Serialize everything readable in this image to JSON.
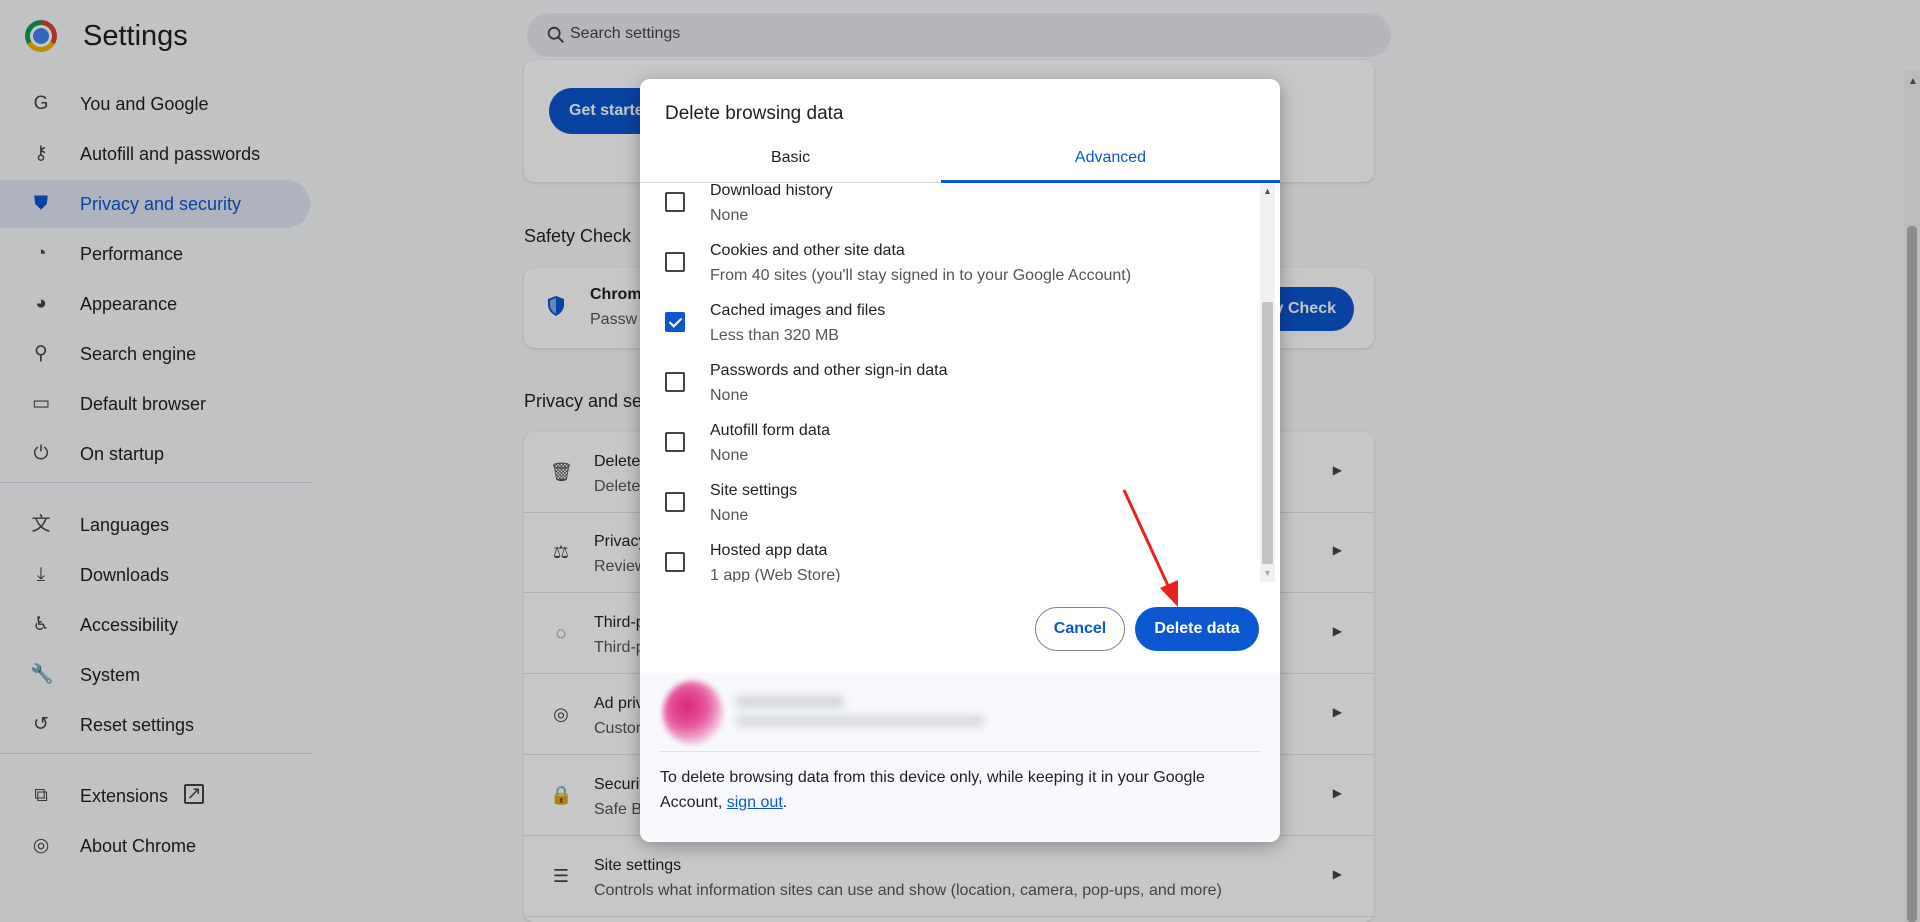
{
  "app": {
    "title": "Settings"
  },
  "search": {
    "placeholder": "Search settings"
  },
  "sidebar": {
    "items": [
      {
        "label": "You and Google",
        "icon": "google-icon"
      },
      {
        "label": "Autofill and passwords",
        "icon": "key-icon"
      },
      {
        "label": "Privacy and security",
        "icon": "shield-icon",
        "active": true
      },
      {
        "label": "Performance",
        "icon": "speedometer-icon"
      },
      {
        "label": "Appearance",
        "icon": "palette-icon"
      },
      {
        "label": "Search engine",
        "icon": "search-icon"
      },
      {
        "label": "Default browser",
        "icon": "browser-window-icon"
      },
      {
        "label": "On startup",
        "icon": "power-icon"
      },
      {
        "label": "Languages",
        "icon": "translate-icon"
      },
      {
        "label": "Downloads",
        "icon": "download-icon"
      },
      {
        "label": "Accessibility",
        "icon": "accessibility-icon"
      },
      {
        "label": "System",
        "icon": "wrench-icon"
      },
      {
        "label": "Reset settings",
        "icon": "reset-icon"
      },
      {
        "label": "Extensions",
        "icon": "puzzle-icon"
      },
      {
        "label": "About Chrome",
        "icon": "chrome-icon"
      }
    ]
  },
  "main": {
    "get_started": "Get starte",
    "safety_check_title": "Safety Check",
    "safety_check_row_title": "Chrom",
    "safety_check_row_sub": "Passw",
    "safety_check_button": "y Check",
    "privacy_title": "Privacy and se",
    "rows": [
      {
        "title": "Delete",
        "sub": "Delete",
        "icon": "trash-icon"
      },
      {
        "title": "Privacy",
        "sub": "Review",
        "icon": "privacy-guide-icon"
      },
      {
        "title": "Third-p",
        "sub": "Third-p",
        "icon": "cookie-icon"
      },
      {
        "title": "Ad priv",
        "sub": "Custor",
        "icon": "ad-privacy-icon"
      },
      {
        "title": "Securit",
        "sub": "Safe B",
        "icon": "lock-icon"
      },
      {
        "title": "Site settings",
        "sub": "Controls what information sites can use and show (location, camera, pop-ups, and more)",
        "icon": "sliders-icon"
      }
    ]
  },
  "dialog": {
    "title": "Delete browsing data",
    "tabs": {
      "basic": "Basic",
      "advanced": "Advanced"
    },
    "items": [
      {
        "title": "Download history",
        "sub": "None",
        "checked": false
      },
      {
        "title": "Cookies and other site data",
        "sub": "From 40 sites (you'll stay signed in to your Google Account)",
        "checked": false
      },
      {
        "title": "Cached images and files",
        "sub": "Less than 320 MB",
        "checked": true
      },
      {
        "title": "Passwords and other sign-in data",
        "sub": "None",
        "checked": false
      },
      {
        "title": "Autofill form data",
        "sub": "None",
        "checked": false
      },
      {
        "title": "Site settings",
        "sub": "None",
        "checked": false
      },
      {
        "title": "Hosted app data",
        "sub": "1 app (Web Store)",
        "checked": false
      }
    ],
    "cancel": "Cancel",
    "delete": "Delete data",
    "footer_text": "To delete browsing data from this device only, while keeping it in your Google Account,",
    "footer_link": "sign out",
    "footer_end": "."
  },
  "colors": {
    "accent": "#0b57d0",
    "annotation_arrow": "#e8231f"
  }
}
